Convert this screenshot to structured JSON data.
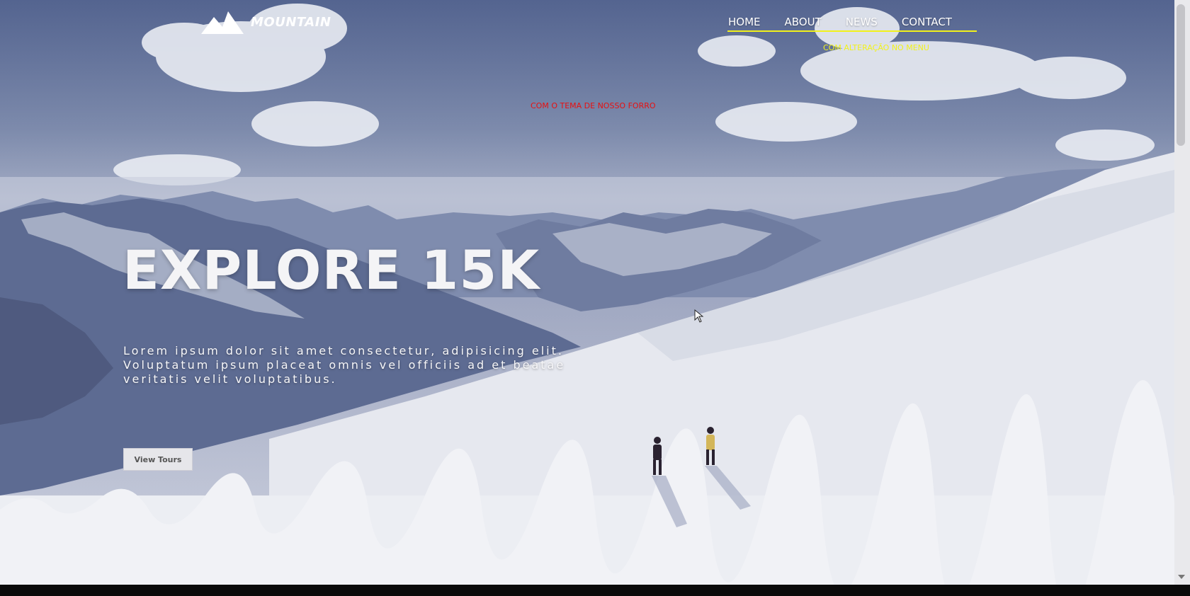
{
  "brand": {
    "name": "MOUNTAIN",
    "logo_icon": "mountain-peaks-icon"
  },
  "nav": {
    "items": [
      {
        "label": "HOME"
      },
      {
        "label": "ABOUT"
      },
      {
        "label": "NEWS"
      },
      {
        "label": "CONTACT"
      }
    ],
    "note": "COM ALTERAÇÃO NO MENU"
  },
  "annotation": {
    "theme_note": "COM O TEMA DE NOSSO FORRO"
  },
  "hero": {
    "title": "EXPLORE 15K",
    "text": "Lorem ipsum dolor sit amet consectetur, adipisicing elit. Voluptatum ipsum placeat omnis vel officiis ad et beatae veritatis velit voluptatibus.",
    "button_label": "View Tours"
  },
  "colors": {
    "nav_underline": "#f2f21b",
    "menu_note": "#f2f21b",
    "theme_note": "#e81010",
    "title": "#f4f4f6"
  },
  "icons": {
    "cursor": "arrow-cursor-icon"
  }
}
